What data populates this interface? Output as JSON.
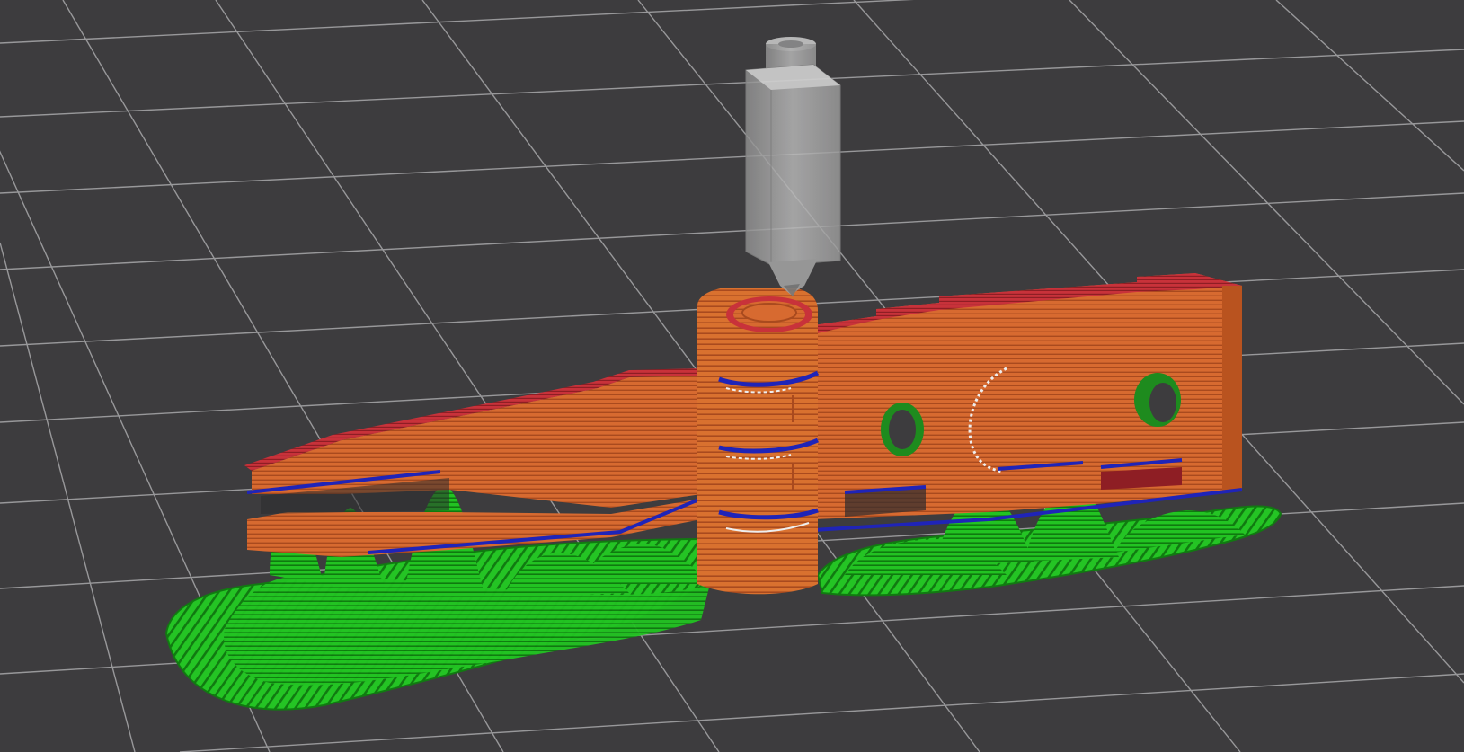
{
  "viewport": {
    "view": "gcode-preview",
    "background_color": "#3d3c3e",
    "grid_color": "#a9a9ab"
  },
  "model": {
    "feature_colors": {
      "perimeter": "#d76a30",
      "perimeter_shadow": "#a94a1e",
      "top_solid_infill": "#c8323a",
      "bridge_infill": "#1f24b8",
      "support_material": "#20c320",
      "support_material_interface": "#0f6e0f",
      "travel_highlight": "#eeeeee"
    }
  },
  "toolhead": {
    "icon": "extruder-nozzle-icon",
    "color": "#a8a8a8"
  }
}
